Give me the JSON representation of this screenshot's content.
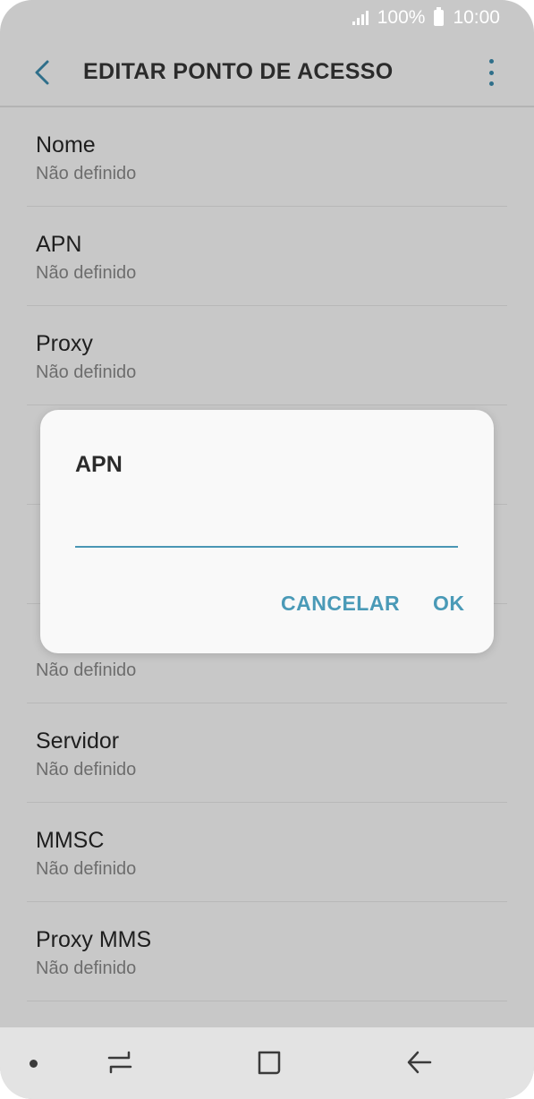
{
  "status_bar": {
    "battery_percent": "100%",
    "time": "10:00"
  },
  "app_bar": {
    "title": "EDITAR PONTO DE ACESSO",
    "back_icon": "chevron-left-icon",
    "more_icon": "more-vertical-icon"
  },
  "list": {
    "items": [
      {
        "label": "Nome",
        "value": "Não definido"
      },
      {
        "label": "APN",
        "value": "Não definido"
      },
      {
        "label": "Proxy",
        "value": "Não definido"
      },
      {
        "label": "",
        "value": ""
      },
      {
        "label": "",
        "value": ""
      },
      {
        "label": "",
        "value": "Não definido"
      },
      {
        "label": "Servidor",
        "value": "Não definido"
      },
      {
        "label": "MMSC",
        "value": "Não definido"
      },
      {
        "label": "Proxy MMS",
        "value": "Não definido"
      }
    ]
  },
  "dialog": {
    "title": "APN",
    "input_value": "",
    "cancel_label": "CANCELAR",
    "ok_label": "OK"
  },
  "colors": {
    "accent": "#4a9ab7",
    "overlay": "#c8c8c8",
    "dialog_bg": "#f9f9f9"
  },
  "nav_bar": {
    "recent_icon": "recent-apps-icon",
    "home_icon": "home-icon",
    "back_icon": "back-arrow-icon"
  }
}
